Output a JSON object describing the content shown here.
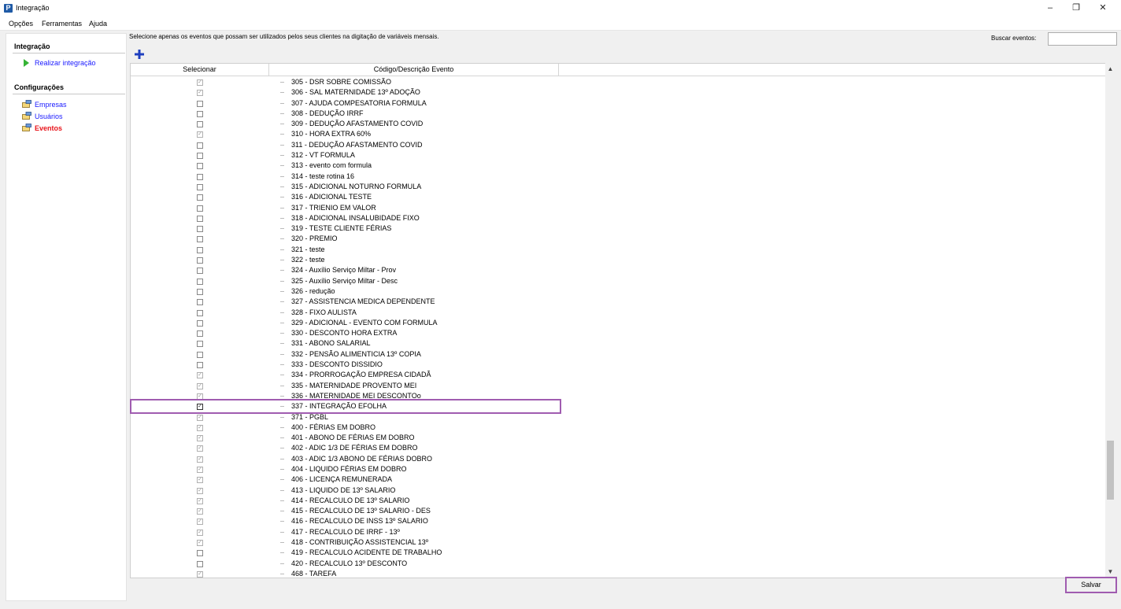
{
  "window": {
    "title": "Integração",
    "icon_letter": "P"
  },
  "window_controls": {
    "minimize": "–",
    "restore": "❐",
    "close": "✕"
  },
  "menu": {
    "items": [
      "Opções",
      "Ferramentas",
      "Ajuda"
    ]
  },
  "sidebar": {
    "integration_title": "Integração",
    "run_link": "Realizar integração",
    "config_title": "Configurações",
    "config_items": [
      "Empresas",
      "Usuários",
      "Eventos"
    ],
    "active_item": "Eventos"
  },
  "main": {
    "instruction": "Selecione apenas os eventos que possam ser utilizados pelos seus clientes na digitação de variáveis mensais.",
    "search_label": "Buscar eventos:",
    "search_value": "",
    "add_icon": "plus-icon",
    "columns": [
      "Selecionar",
      "Código/Descrição Evento"
    ],
    "rows": [
      {
        "checked": true,
        "text": "305 - DSR SOBRE COMISSÃO"
      },
      {
        "checked": true,
        "text": "306 - SAL MATERNIDADE 13º ADOÇÃO"
      },
      {
        "checked": false,
        "text": "307 - AJUDA COMPESATORIA FORMULA"
      },
      {
        "checked": false,
        "text": "308 - DEDUÇÃO IRRF"
      },
      {
        "checked": false,
        "text": "309 - DEDUÇÃO AFASTAMENTO COVID"
      },
      {
        "checked": true,
        "text": "310 - HORA EXTRA 60%"
      },
      {
        "checked": false,
        "text": "311 - DEDUÇÃO AFASTAMENTO COVID"
      },
      {
        "checked": false,
        "text": "312 - VT FORMULA"
      },
      {
        "checked": false,
        "text": "313 - evento com formula"
      },
      {
        "checked": false,
        "text": "314 - teste rotina 16"
      },
      {
        "checked": false,
        "text": "315 - ADICIONAL NOTURNO FORMULA"
      },
      {
        "checked": false,
        "text": "316 - ADICIONAL TESTE"
      },
      {
        "checked": false,
        "text": "317 - TRIENIO EM VALOR"
      },
      {
        "checked": false,
        "text": "318 - ADICIONAL INSALUBIDADE FIXO"
      },
      {
        "checked": false,
        "text": "319 - TESTE CLIENTE FÉRIAS"
      },
      {
        "checked": false,
        "text": "320 - PREMIO"
      },
      {
        "checked": false,
        "text": "321 - teste"
      },
      {
        "checked": false,
        "text": "322 - teste"
      },
      {
        "checked": false,
        "text": "324 - Auxílio Serviço Miltar - Prov"
      },
      {
        "checked": false,
        "text": "325 - Auxílio Serviço Miltar - Desc"
      },
      {
        "checked": false,
        "text": "326 - redução"
      },
      {
        "checked": false,
        "text": "327 - ASSISTENCIA MEDICA DEPENDENTE"
      },
      {
        "checked": false,
        "text": "328 - FIXO AULISTA"
      },
      {
        "checked": false,
        "text": "329 - ADICIONAL - EVENTO COM FORMULA"
      },
      {
        "checked": false,
        "text": "330 - DESCONTO HORA EXTRA"
      },
      {
        "checked": false,
        "text": "331 - ABONO SALARIAL"
      },
      {
        "checked": false,
        "text": "332 - PENSÃO ALIMENTICIA 13º COPIA"
      },
      {
        "checked": false,
        "text": "333 - DESCONTO DISSIDIO"
      },
      {
        "checked": true,
        "text": "334 - PRORROGAÇÃO EMPRESA CIDADÃ"
      },
      {
        "checked": true,
        "text": "335 - MATERNIDADE PROVENTO MEI"
      },
      {
        "checked": true,
        "text": "336 - MATERNIDADE MEI DESCONTOo"
      },
      {
        "checked": true,
        "strong": true,
        "text": "337 - INTEGRAÇÃO EFOLHA"
      },
      {
        "checked": true,
        "text": "371 - PGBL"
      },
      {
        "checked": true,
        "text": "400 - FÉRIAS EM DOBRO"
      },
      {
        "checked": true,
        "text": "401 - ABONO DE FÉRIAS EM DOBRO"
      },
      {
        "checked": true,
        "text": "402 - ADIC 1/3 DE FÉRIAS EM DOBRO"
      },
      {
        "checked": true,
        "text": "403 - ADIC 1/3 ABONO DE FÉRIAS DOBRO"
      },
      {
        "checked": true,
        "text": "404 - LIQUIDO FÉRIAS EM DOBRO"
      },
      {
        "checked": true,
        "text": "406 - LICENÇA REMUNERADA"
      },
      {
        "checked": true,
        "text": "413 - LIQUIDO DE 13º SALARIO"
      },
      {
        "checked": true,
        "text": "414 - RECALCULO DE 13º SALARIO"
      },
      {
        "checked": true,
        "text": "415 - RECALCULO DE 13º SALARIO - DES"
      },
      {
        "checked": true,
        "text": "416 - RECALCULO DE INSS 13º SALARIO"
      },
      {
        "checked": true,
        "text": "417 - RECALCULO DE IRRF - 13º"
      },
      {
        "checked": true,
        "text": "418 - CONTRIBUIÇÃO ASSISTENCIAL 13º"
      },
      {
        "checked": false,
        "text": "419 - RECALCULO ACIDENTE DE TRABALHO"
      },
      {
        "checked": false,
        "text": "420 - RECALCULO 13º DESCONTO"
      },
      {
        "checked": true,
        "text": "468 - TAREFA"
      }
    ]
  },
  "footer": {
    "save_label": "Salvar"
  },
  "colors": {
    "accent_box": "#a05cb0",
    "active_link": "#e8141b",
    "link": "#1a1aff",
    "add_icon": "#1f3fbf"
  }
}
